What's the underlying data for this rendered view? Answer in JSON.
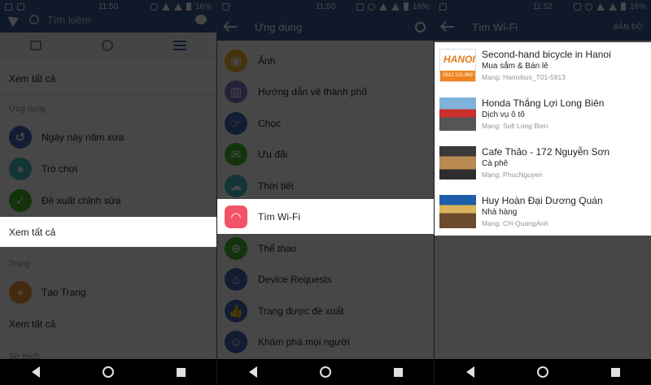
{
  "panel1": {
    "status": {
      "time": "11:50",
      "battery": "16%"
    },
    "search_placeholder": "Tìm kiếm",
    "tabs": [
      "feed-tab",
      "globe-tab",
      "menu-tab"
    ],
    "see_all_1": "Xem tất cả",
    "section_apps": "Ứng dụng",
    "items": [
      {
        "label": "Ngày này năm xưa",
        "color": "#4267b2",
        "icon": "history-icon"
      },
      {
        "label": "Trò chơi",
        "color": "#44bec7",
        "icon": "games-icon"
      },
      {
        "label": "Đề xuất chỉnh sửa",
        "color": "#42b72a",
        "icon": "check-icon"
      }
    ],
    "see_all_2": "Xem tất cả",
    "section_pages": "Trang",
    "create_page": "Tạo Trang",
    "create_page_color": "#f7923b",
    "see_all_3": "Xem tất cả",
    "section_interests": "Sở thích"
  },
  "panel2": {
    "status": {
      "time": "11:50",
      "battery": "16%"
    },
    "title": "Ứng dụng",
    "items": [
      {
        "label": "Ảnh",
        "color": "#f7b928",
        "icon": "photo-icon"
      },
      {
        "label": "Hướng dẫn về thành phố",
        "color": "#8c72cb",
        "icon": "city-icon"
      },
      {
        "label": "Chọc",
        "color": "#4267b2",
        "icon": "poke-icon"
      },
      {
        "label": "Ưu đãi",
        "color": "#42b72a",
        "icon": "offer-icon"
      },
      {
        "label": "Thời tiết",
        "color": "#44bec7",
        "icon": "weather-icon"
      },
      {
        "label": "Tìm Wi-Fi",
        "color": "#f35369",
        "icon": "wifi-icon"
      },
      {
        "label": "Thể thao",
        "color": "#42b72a",
        "icon": "sports-icon"
      },
      {
        "label": "Device Requests",
        "color": "#4267b2",
        "icon": "device-icon"
      },
      {
        "label": "Trang được đề xuất",
        "color": "#4267b2",
        "icon": "thumbs-up-icon"
      },
      {
        "label": "Khám phá mọi người",
        "color": "#4267b2",
        "icon": "discover-people-icon"
      }
    ]
  },
  "panel3": {
    "status": {
      "time": "11:52",
      "battery": "16%"
    },
    "title": "Tìm Wi-Fi",
    "map_label": "BẢN ĐỒ",
    "results": [
      {
        "title": "Second-hand bicycle in Hanoi",
        "category": "Mua sắm & Bán lẻ",
        "network": "Mạng: Hanoibus_T01-5913",
        "thumb_text": "HANOI",
        "thumb_sub": "0912.101.969"
      },
      {
        "title": "Honda Thắng Lợi Long Biên",
        "category": "Dịch vụ ô tô",
        "network": "Mạng: Sofi Long Bien"
      },
      {
        "title": "Cafe Thảo - 172 Nguyễn Sơn",
        "category": "Cà phê",
        "network": "Mạng: PhucNguyen"
      },
      {
        "title": "Huy Hoàn Đại Dương Quán",
        "category": "Nhà hàng",
        "network": "Mạng: CH-QuangAnh"
      }
    ]
  }
}
